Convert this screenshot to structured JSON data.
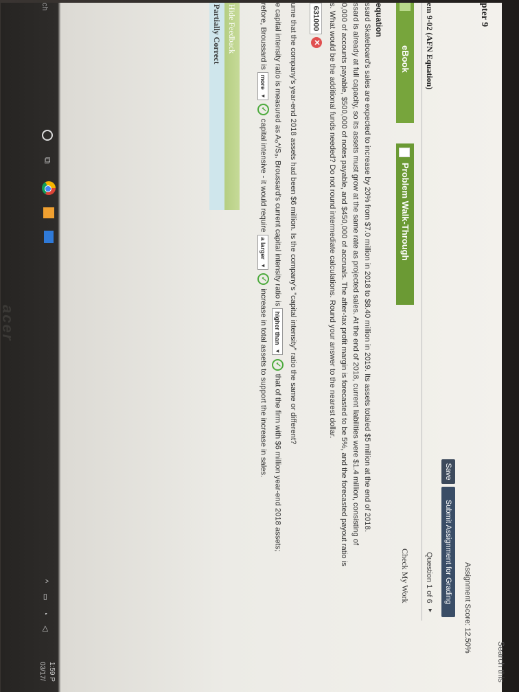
{
  "header": {
    "search_text": "Search this",
    "chapter": "pter 9",
    "assignment_score": "Assignment Score: 12.50%",
    "save_label": "Save",
    "submit_label": "Submit Assignment for Grading",
    "problem_title": "em 9-02 (AFN Equation)",
    "question_counter": "Question 1 of 6",
    "next_arrow": "▸"
  },
  "tabs": {
    "ebook": "eBook",
    "walkthrough": "Problem Walk-Through",
    "check_work": "Check My Work"
  },
  "content": {
    "term": "equation",
    "lines": [
      "ssard Skateboard's sales are expected to increase by 20% from $7.0 million in 2018 to $8.40 million in 2019. Its assets totaled $5 million at the end of 2018.",
      "ssard is already at full capacity, so its assets must grow at the same rate as projected sales. At the end of 2018, current liabilities were $1.4 million, consisting of",
      "0,000 of accounts payable, $500,000 of notes payable, and $450,000 of accruals. The after-tax profit margin is forecasted to be 5%, and the forecasted payout ratio is",
      "s. What would be the additional funds needed? Do not round intermediate calculations. Round your answer to the nearest dollar."
    ],
    "answer_value": "631000",
    "incorrect_mark": "✕",
    "question2": "ume that the company's year-end 2018 assets had been $6 million. Is the company's \"capital intensity\" ratio the same or different?",
    "q3_part1": "e capital intensity ratio is measured as A₀*/S₀. Broussard's current capital intensity ratio is",
    "q3_dropdown": "higher than",
    "q3_part2": "that of the firm with $6 million year-end 2018 assets;",
    "q4_part1": "refore, Broussard is",
    "q4_dropdown1": "more",
    "q4_part2": "capital intensive - it would require",
    "q4_dropdown2": "a larger",
    "q4_part3": "increase in total assets to support the increase in sales.",
    "correct_mark": "✓",
    "dropdown_arrow": "▾"
  },
  "feedback": {
    "hide_label": "Hide Feedback",
    "status": "Partially Correct"
  },
  "taskbar": {
    "search_stub": "ch",
    "task_view_glyph": "⧉",
    "tray_icons": "^ ▭ ◔ ◁",
    "time": "1:59 P",
    "date": "03/17/"
  },
  "monitor": {
    "brand": "acer"
  }
}
